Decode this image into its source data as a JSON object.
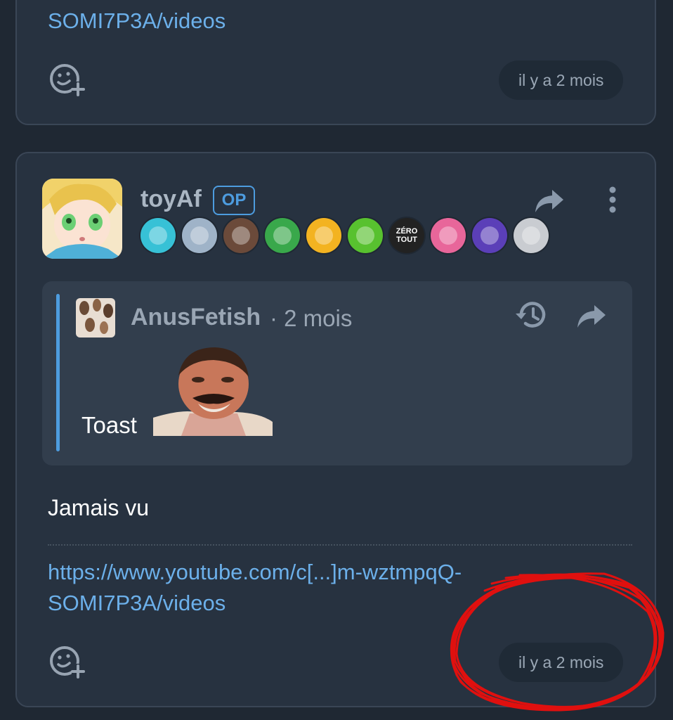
{
  "top_card": {
    "link_tail": "SOMI7P3A/videos",
    "timestamp": "il y a 2 mois"
  },
  "post": {
    "author": "toyAf",
    "op_label": "OP",
    "badges": [
      {
        "name": "stars-badge",
        "color": "#37c1d6",
        "text": ""
      },
      {
        "name": "old-man-badge",
        "color": "#9fb3c8",
        "text": ""
      },
      {
        "name": "strong-man-badge",
        "color": "#6b4a3a",
        "text": ""
      },
      {
        "name": "santa-badge",
        "color": "#39a84b",
        "text": ""
      },
      {
        "name": "smiley-badge",
        "color": "#f3b321",
        "text": ""
      },
      {
        "name": "beer-badge",
        "color": "#58c12f",
        "text": ""
      },
      {
        "name": "zero-tout-badge",
        "color": "#222222",
        "text": "ZÉRO TOUT"
      },
      {
        "name": "anime-girl-badge",
        "color": "#e8669a",
        "text": ""
      },
      {
        "name": "moon-badge",
        "color": "#5b3fb8",
        "text": ""
      },
      {
        "name": "risitas-badge",
        "color": "#c9ccd1",
        "text": ""
      }
    ],
    "quote": {
      "author": "AnusFetish",
      "time": "· 2 mois",
      "text": "Toast"
    },
    "body": "Jamais vu",
    "link_line1": "https://www.youtube.com/c[...]m-wztmpqQ-",
    "link_line2": "SOMI7P3A/videos",
    "timestamp": "il y a 2 mois"
  },
  "colors": {
    "background": "#1f2833",
    "card": "#273240",
    "link": "#6cb0ea",
    "accent": "#4d9cdf",
    "annotation": "#e0100f"
  }
}
